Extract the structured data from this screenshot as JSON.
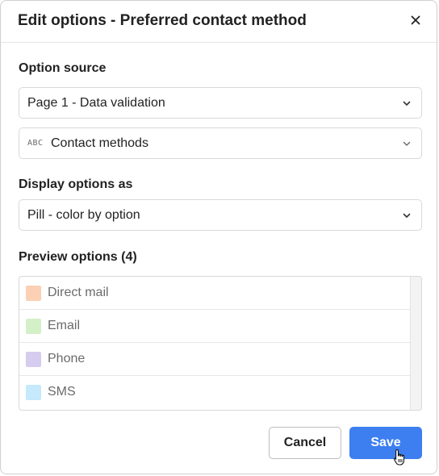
{
  "dialog": {
    "title": "Edit options - Preferred contact method",
    "close_icon": "close-icon"
  },
  "option_source": {
    "label": "Option source",
    "page_select": "Page 1 - Data validation",
    "field_select": "Contact methods",
    "field_type_badge": "ABC"
  },
  "display": {
    "label": "Display options as",
    "value": "Pill - color by option"
  },
  "preview": {
    "label": "Preview options (4)",
    "options": [
      {
        "label": "Direct mail",
        "color": "#fbd0b4"
      },
      {
        "label": "Email",
        "color": "#d3f0c8"
      },
      {
        "label": "Phone",
        "color": "#d6ccef"
      },
      {
        "label": "SMS",
        "color": "#c6e9fb"
      }
    ]
  },
  "footer": {
    "cancel_label": "Cancel",
    "save_label": "Save"
  },
  "colors": {
    "primary": "#3d7ff0",
    "border": "#d9d9d9"
  }
}
